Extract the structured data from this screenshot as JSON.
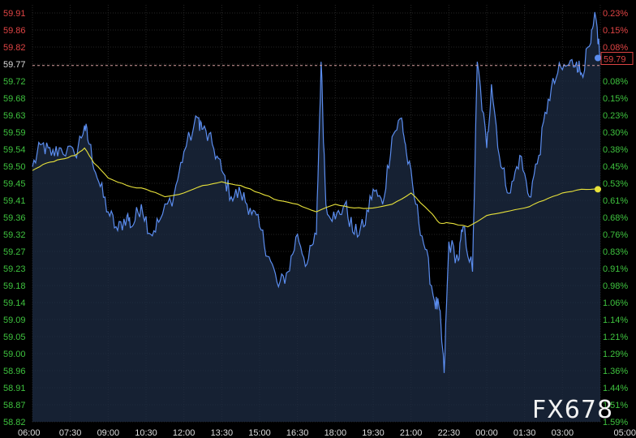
{
  "colors": {
    "background": "#000000",
    "grid": "#262626",
    "up": "#e04444",
    "down": "#3ec23e",
    "price_line": "#5b8def",
    "price_fill": "#1e2c44",
    "average_line": "#e8e23a",
    "reference_line": "#d9a0a0",
    "axis_text": "#dcdcdc"
  },
  "watermark": "FX678",
  "chart_data": {
    "type": "line",
    "x_ticks": [
      "06:00",
      "07:30",
      "09:00",
      "10:30",
      "12:00",
      "13:30",
      "15:00",
      "16:30",
      "18:00",
      "19:30",
      "21:00",
      "22:30",
      "00:00",
      "01:30",
      "03:00",
      "05:00"
    ],
    "y_left_ticks": [
      "59.91",
      "59.86",
      "59.82",
      "59.77",
      "59.72",
      "59.68",
      "59.63",
      "59.59",
      "59.54",
      "59.50",
      "59.45",
      "59.41",
      "59.36",
      "59.32",
      "59.27",
      "59.23",
      "59.18",
      "59.14",
      "59.09",
      "59.05",
      "59.00",
      "58.96",
      "58.91",
      "58.87",
      "58.82"
    ],
    "y_right_ticks": [
      "0.23%",
      "0.15%",
      "0.08%",
      "",
      "0.08%",
      "0.15%",
      "0.23%",
      "0.30%",
      "0.38%",
      "0.45%",
      "0.53%",
      "0.61%",
      "0.68%",
      "0.76%",
      "0.83%",
      "0.91%",
      "0.98%",
      "1.06%",
      "1.14%",
      "1.21%",
      "1.29%",
      "1.36%",
      "1.44%",
      "1.51%",
      "1.59%"
    ],
    "ylim": [
      58.82,
      59.91
    ],
    "reference_price": 59.77,
    "last_price_label": "59.79",
    "grid": true,
    "series": [
      {
        "role": "price",
        "style": "area",
        "anchors": [
          [
            0,
            59.5
          ],
          [
            2,
            59.56
          ],
          [
            4,
            59.53
          ],
          [
            6,
            59.55
          ],
          [
            9,
            59.53
          ],
          [
            11,
            59.61
          ],
          [
            12,
            59.56
          ],
          [
            14,
            59.46
          ],
          [
            16,
            59.38
          ],
          [
            18,
            59.33
          ],
          [
            20,
            59.37
          ],
          [
            21,
            59.34
          ],
          [
            23,
            59.4
          ],
          [
            25,
            59.32
          ],
          [
            27,
            59.36
          ],
          [
            30,
            59.43
          ],
          [
            32,
            59.54
          ],
          [
            35,
            59.63
          ],
          [
            36,
            59.6
          ],
          [
            38,
            59.56
          ],
          [
            40,
            59.49
          ],
          [
            42,
            59.42
          ],
          [
            44,
            59.43
          ],
          [
            46,
            59.39
          ],
          [
            48,
            59.34
          ],
          [
            50,
            59.26
          ],
          [
            52,
            59.18
          ],
          [
            54,
            59.22
          ],
          [
            56,
            59.32
          ],
          [
            58,
            59.24
          ],
          [
            60,
            59.32
          ],
          [
            61,
            59.78
          ],
          [
            62,
            59.4
          ],
          [
            64,
            59.36
          ],
          [
            66,
            59.4
          ],
          [
            68,
            59.32
          ],
          [
            70,
            59.34
          ],
          [
            72,
            59.44
          ],
          [
            74,
            59.4
          ],
          [
            76,
            59.58
          ],
          [
            78,
            59.63
          ],
          [
            79,
            59.54
          ],
          [
            81,
            59.4
          ],
          [
            83,
            59.28
          ],
          [
            85,
            59.14
          ],
          [
            86,
            59.12
          ],
          [
            87,
            58.95
          ],
          [
            88,
            59.3
          ],
          [
            90,
            59.25
          ],
          [
            91,
            59.34
          ],
          [
            93,
            59.22
          ],
          [
            94,
            59.78
          ],
          [
            96,
            59.55
          ],
          [
            97,
            59.72
          ],
          [
            99,
            59.5
          ],
          [
            101,
            59.43
          ],
          [
            103,
            59.53
          ],
          [
            105,
            59.42
          ],
          [
            107,
            59.53
          ],
          [
            109,
            59.68
          ],
          [
            111,
            59.75
          ],
          [
            113,
            59.77
          ],
          [
            115,
            59.78
          ],
          [
            116,
            59.75
          ],
          [
            118,
            59.83
          ],
          [
            119,
            59.9
          ],
          [
            120,
            59.79
          ]
        ]
      },
      {
        "role": "average",
        "style": "line",
        "anchors": [
          [
            0,
            59.49
          ],
          [
            3,
            59.51
          ],
          [
            6,
            59.52
          ],
          [
            9,
            59.53
          ],
          [
            11,
            59.55
          ],
          [
            13,
            59.51
          ],
          [
            16,
            59.47
          ],
          [
            20,
            59.45
          ],
          [
            24,
            59.44
          ],
          [
            28,
            59.42
          ],
          [
            32,
            59.43
          ],
          [
            36,
            59.45
          ],
          [
            40,
            59.46
          ],
          [
            44,
            59.45
          ],
          [
            48,
            59.43
          ],
          [
            52,
            59.41
          ],
          [
            56,
            59.4
          ],
          [
            60,
            59.38
          ],
          [
            64,
            59.4
          ],
          [
            68,
            59.39
          ],
          [
            72,
            59.39
          ],
          [
            76,
            59.4
          ],
          [
            80,
            59.43
          ],
          [
            84,
            59.38
          ],
          [
            86,
            59.35
          ],
          [
            88,
            59.35
          ],
          [
            92,
            59.34
          ],
          [
            96,
            59.37
          ],
          [
            100,
            59.38
          ],
          [
            104,
            59.39
          ],
          [
            108,
            59.41
          ],
          [
            112,
            59.43
          ],
          [
            116,
            59.44
          ],
          [
            120,
            59.44
          ]
        ]
      }
    ]
  }
}
